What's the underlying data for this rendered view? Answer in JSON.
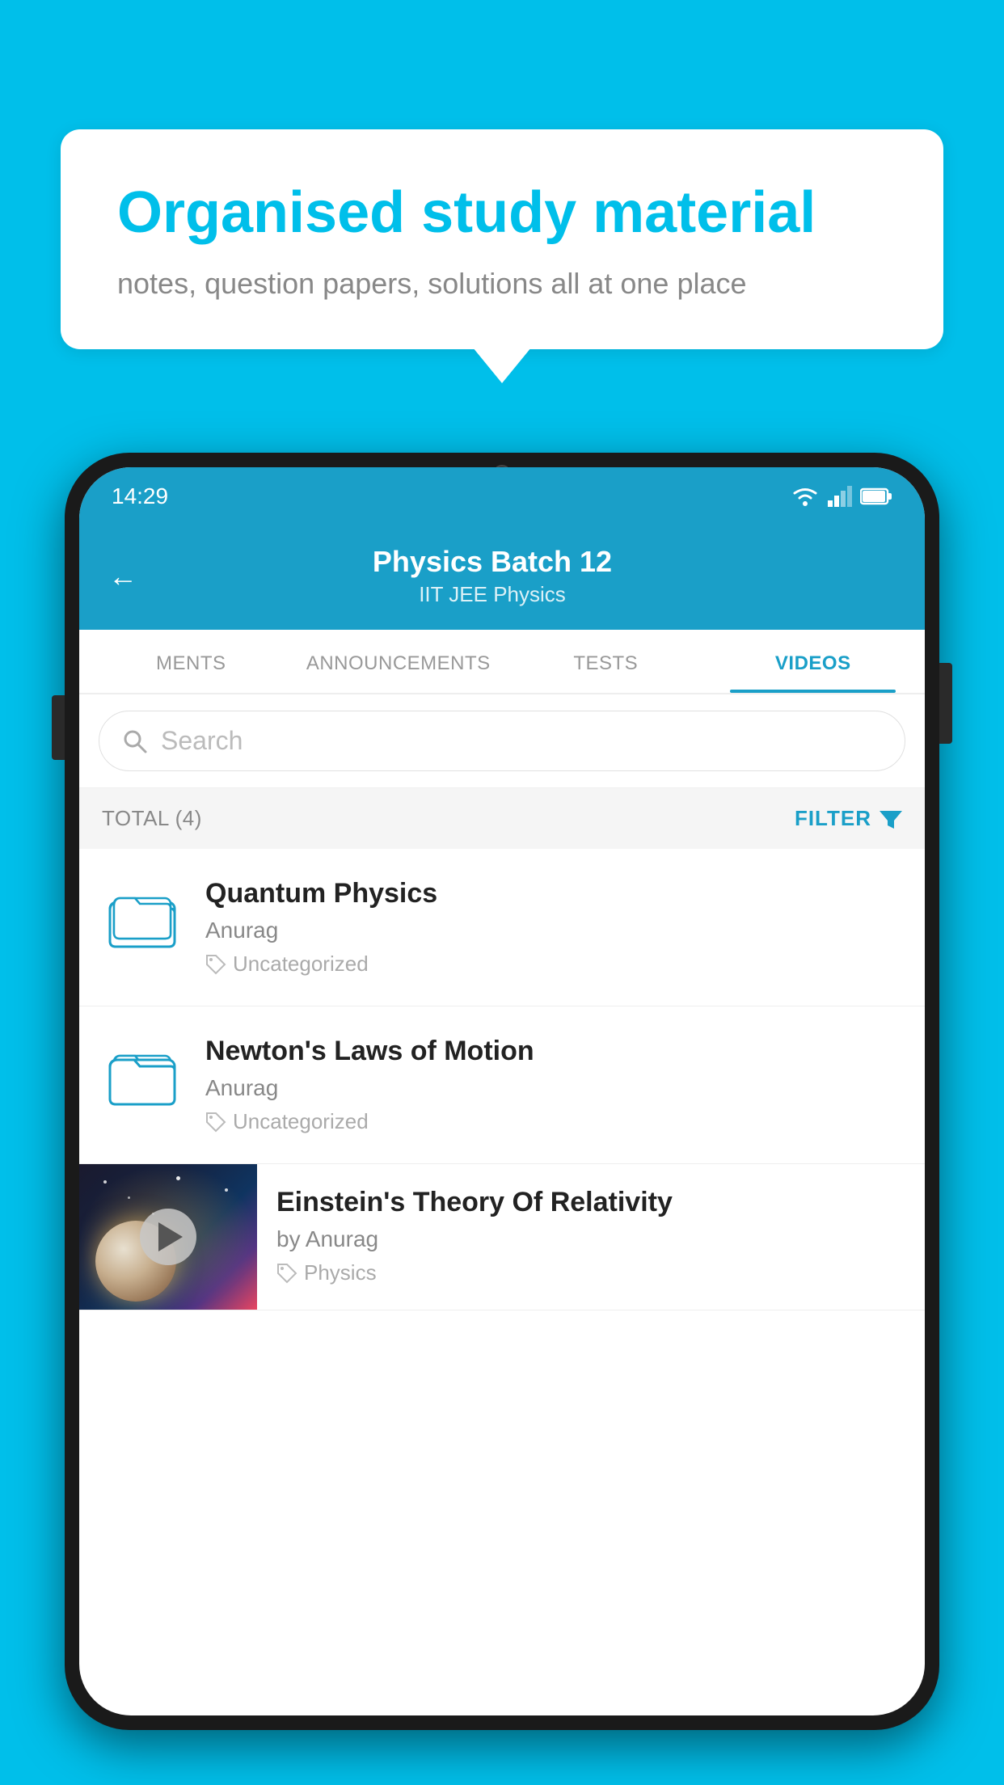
{
  "bubble": {
    "title": "Organised study material",
    "subtitle": "notes, question papers, solutions all at one place"
  },
  "status_bar": {
    "time": "14:29"
  },
  "app_bar": {
    "title": "Physics Batch 12",
    "subtitle": "IIT JEE   Physics"
  },
  "tabs": [
    {
      "label": "MENTS",
      "active": false
    },
    {
      "label": "ANNOUNCEMENTS",
      "active": false
    },
    {
      "label": "TESTS",
      "active": false
    },
    {
      "label": "VIDEOS",
      "active": true
    }
  ],
  "search": {
    "placeholder": "Search"
  },
  "filter_bar": {
    "total_label": "TOTAL (4)",
    "filter_label": "FILTER"
  },
  "videos": [
    {
      "title": "Quantum Physics",
      "author": "Anurag",
      "tag": "Uncategorized",
      "type": "folder"
    },
    {
      "title": "Newton's Laws of Motion",
      "author": "Anurag",
      "tag": "Uncategorized",
      "type": "folder"
    },
    {
      "title": "Einstein's Theory Of Relativity",
      "author": "by Anurag",
      "tag": "Physics",
      "type": "video"
    }
  ]
}
